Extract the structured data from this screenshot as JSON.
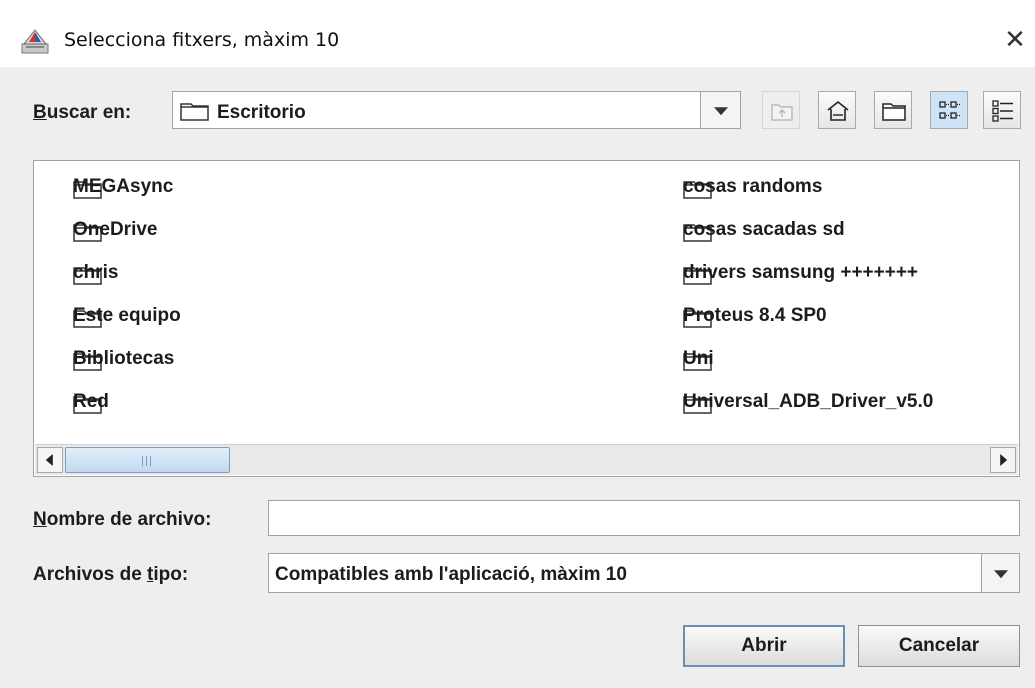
{
  "window": {
    "title": "Selecciona fitxers, màxim 10",
    "close_glyph": "✕",
    "app_icon": "java-app-icon"
  },
  "look_in": {
    "label_mnemonic": "B",
    "label_rest": "uscar en:",
    "selected_folder": "Escritorio"
  },
  "toolbar": {
    "buttons": [
      {
        "name": "up-one-level-icon",
        "enabled": false
      },
      {
        "name": "home-icon",
        "enabled": true
      },
      {
        "name": "new-folder-icon",
        "enabled": true
      },
      {
        "name": "list-view-icon",
        "enabled": true,
        "selected": true
      },
      {
        "name": "details-view-icon",
        "enabled": true
      }
    ]
  },
  "files": [
    {
      "name": "MEGAsync"
    },
    {
      "name": "OneDrive"
    },
    {
      "name": "chris"
    },
    {
      "name": "Este equipo"
    },
    {
      "name": "Bibliotecas"
    },
    {
      "name": "Red"
    },
    {
      "name": "cosas randoms"
    },
    {
      "name": "cosas sacadas sd"
    },
    {
      "name": "drivers samsung +++++++"
    },
    {
      "name": "Proteus 8.4 SP0"
    },
    {
      "name": "Uni"
    },
    {
      "name": "Universal_ADB_Driver_v5.0"
    }
  ],
  "file_name": {
    "label_mnemonic": "N",
    "label_rest": "ombre de archivo:",
    "value": ""
  },
  "file_type": {
    "label_before": "Archivos de ",
    "label_mnemonic": "t",
    "label_after": "ipo:",
    "selected": "Compatibles amb l'aplicació, màxim 10"
  },
  "buttons": {
    "open": "Abrir",
    "cancel": "Cancelar"
  },
  "colors": {
    "accent_default_button": "#6a8fb5",
    "scroll_thumb": "#c2d8f0"
  }
}
